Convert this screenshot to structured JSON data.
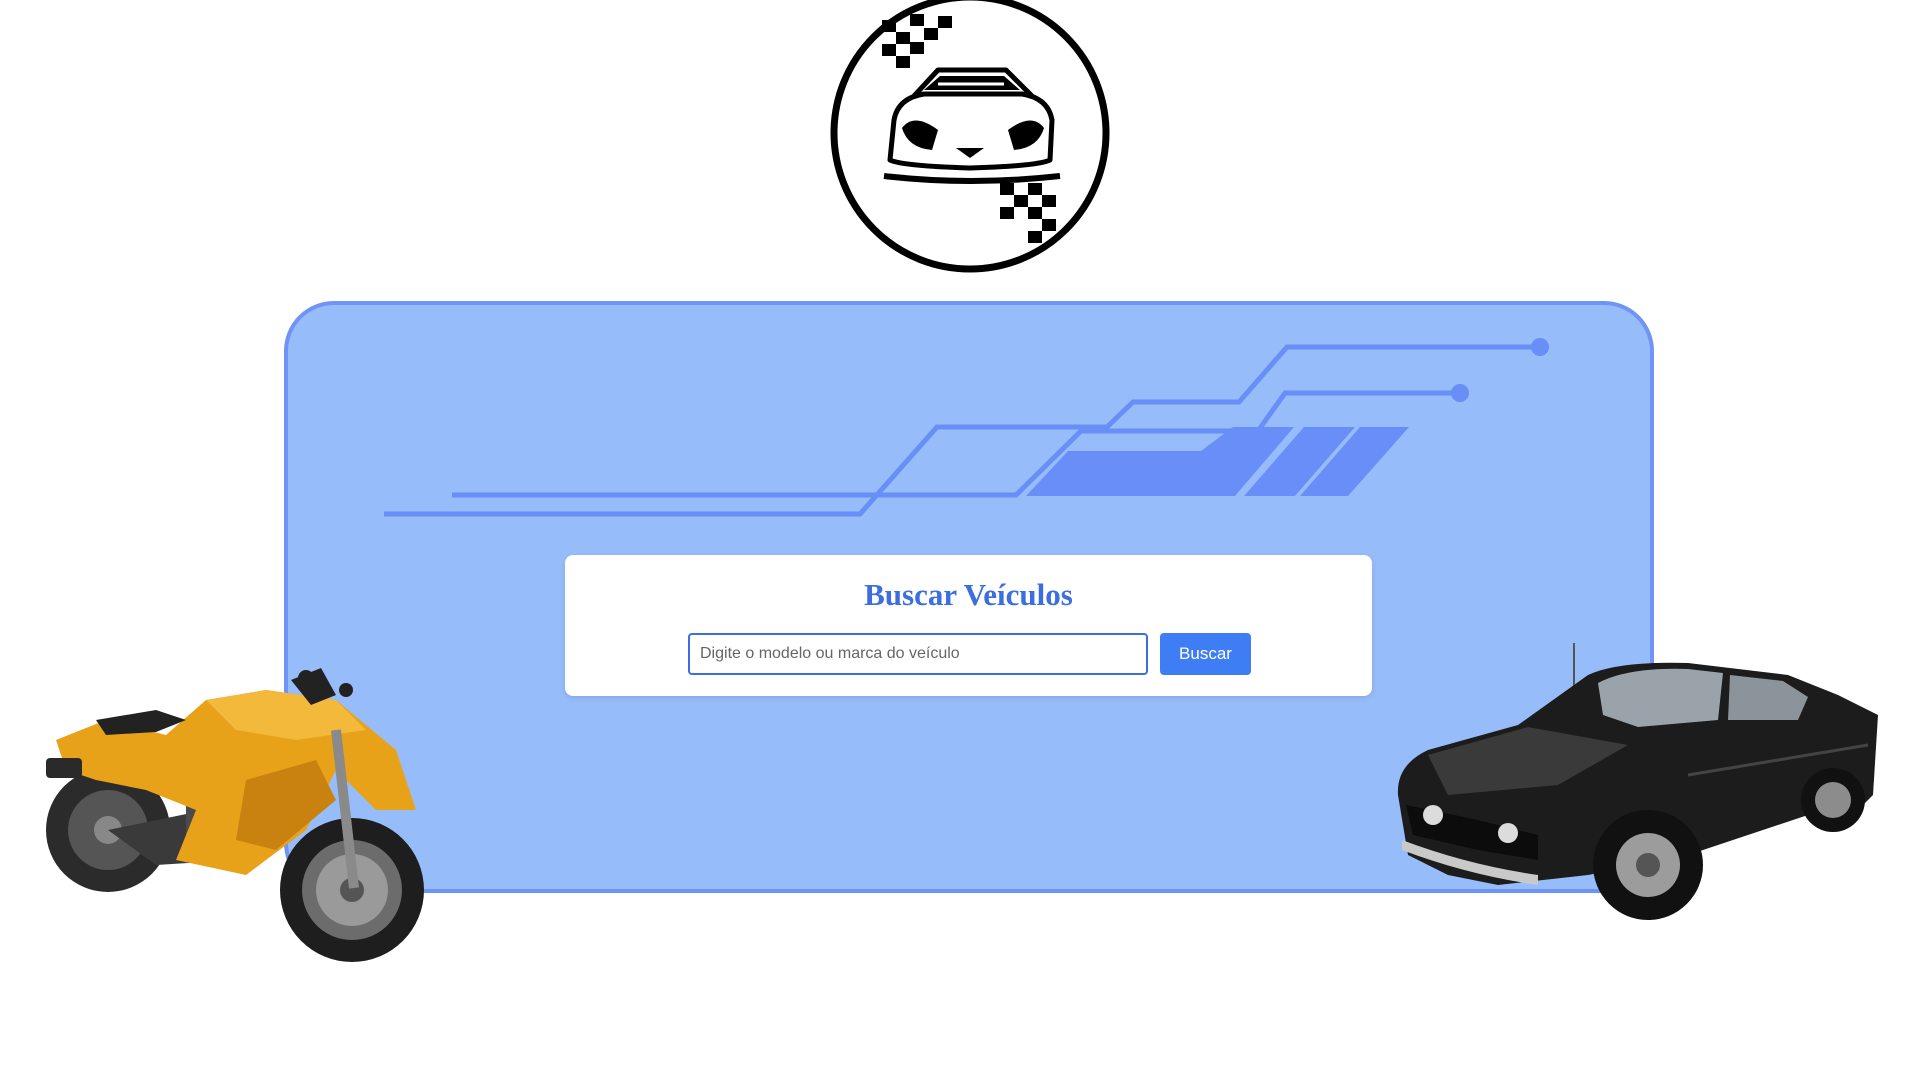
{
  "search": {
    "title": "Buscar Veículos",
    "input_value": "",
    "placeholder": "Digite o modelo ou marca do veículo",
    "button_label": "Buscar"
  },
  "icons": {
    "logo": "race-car-logo-icon",
    "motorcycle": "sport-motorcycle-image",
    "car": "muscle-car-image"
  },
  "colors": {
    "panel_bg": "#97bcfa",
    "panel_border": "#6f94f5",
    "accent": "#3f7df5",
    "title": "#3b6fe0",
    "deco": "#6a8ef7"
  }
}
